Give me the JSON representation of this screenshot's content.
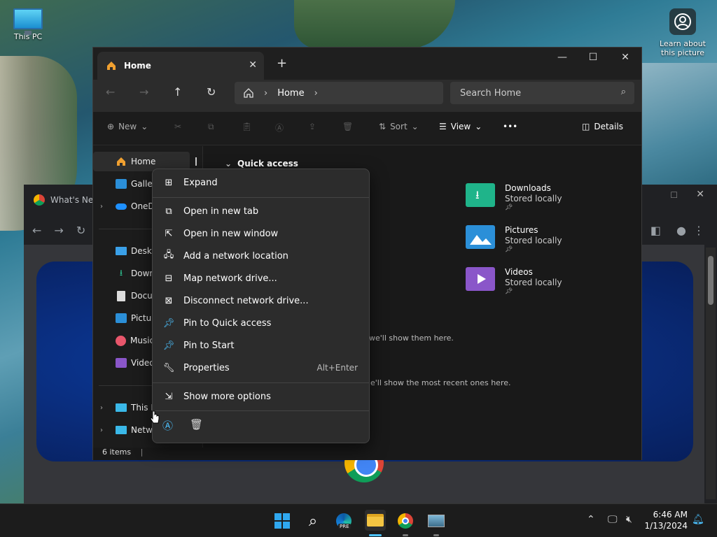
{
  "desktop": {
    "this_pc_label": "This PC",
    "learn_label_1": "Learn about",
    "learn_label_2": "this picture"
  },
  "chrome": {
    "tab_title": "What's Ne",
    "bg_color": "#202124"
  },
  "explorer": {
    "tab_title": "Home",
    "new_tab_symbol": "+",
    "address": {
      "crumb": "Home"
    },
    "search": {
      "placeholder": "Search Home"
    },
    "commands": {
      "new": "New",
      "sort": "Sort",
      "view": "View",
      "details": "Details"
    },
    "sidebar": {
      "items": [
        {
          "label": "Home",
          "icon": "home-icon"
        },
        {
          "label": "Galler",
          "icon": "gallery-icon"
        },
        {
          "label": "OneD",
          "icon": "onedrive-icon"
        },
        {
          "label": "Deskt",
          "icon": "desktop-icon"
        },
        {
          "label": "Down",
          "icon": "downloads-icon"
        },
        {
          "label": "Docu",
          "icon": "documents-icon"
        },
        {
          "label": "Pictur",
          "icon": "pictures-icon"
        },
        {
          "label": "Music",
          "icon": "music-icon"
        },
        {
          "label": "Video",
          "icon": "videos-icon"
        },
        {
          "label": "This P",
          "icon": "this-pc-icon"
        },
        {
          "label": "Netw",
          "icon": "network-icon"
        }
      ]
    },
    "main": {
      "quick_access": "Quick access",
      "folders": [
        {
          "name": "Downloads",
          "sub": "Stored locally",
          "color": "#1fb48a"
        },
        {
          "name": "Pictures",
          "sub": "Stored locally",
          "color": "#2b8fd8"
        },
        {
          "name": "Videos",
          "sub": "Stored locally",
          "color": "#8a56c9"
        }
      ],
      "hint_favorites": "we'll show them here.",
      "hint_recent": "e'll show the most recent ones here."
    },
    "status": "6 items"
  },
  "context_menu": {
    "items": [
      {
        "label": "Expand",
        "icon": "expand-icon"
      },
      {
        "label": "Open in new tab",
        "icon": "open-new-tab-icon"
      },
      {
        "label": "Open in new window",
        "icon": "open-new-window-icon"
      },
      {
        "label": "Add a network location",
        "icon": "network-location-icon"
      },
      {
        "label": "Map network drive...",
        "icon": "map-drive-icon"
      },
      {
        "label": "Disconnect network drive...",
        "icon": "disconnect-drive-icon"
      },
      {
        "label": "Pin to Quick access",
        "icon": "pin-icon"
      },
      {
        "label": "Pin to Start",
        "icon": "pin-start-icon"
      },
      {
        "label": "Properties",
        "icon": "properties-icon",
        "shortcut": "Alt+Enter"
      },
      {
        "label": "Show more options",
        "icon": "more-options-icon"
      }
    ]
  },
  "taskbar": {
    "time": "6:46 AM",
    "date": "1/13/2024",
    "edge_badge": "PRE"
  },
  "colors": {
    "accent": "#4cc2ff",
    "explorer_bg": "#191919",
    "menu_bg": "#2c2c2c"
  }
}
